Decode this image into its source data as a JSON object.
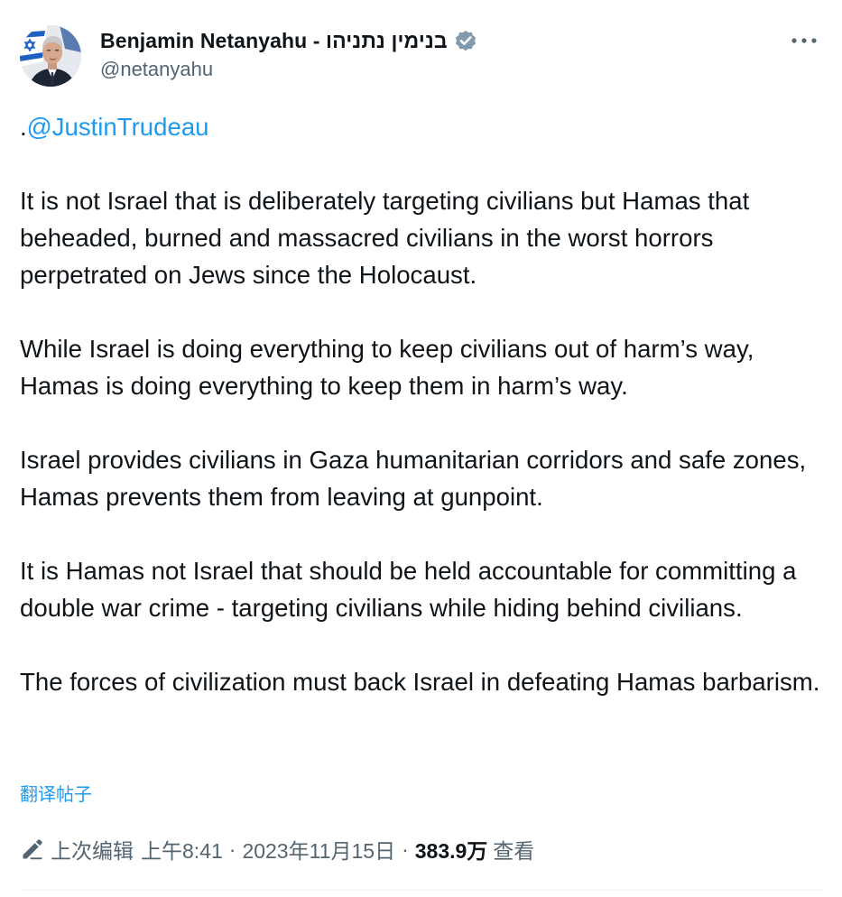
{
  "author": {
    "display_name": "Benjamin Netanyahu - בנימין נתניהו",
    "handle": "@netanyahu",
    "verified_badge_color": "#829aab"
  },
  "tweet": {
    "lead_punct": ".",
    "mention": "@JustinTrudeau",
    "paragraphs": [
      "It is not Israel that is deliberately targeting civilians but Hamas that beheaded, burned and massacred civilians in the worst horrors perpetrated on Jews since the Holocaust.",
      "While Israel is doing everything to keep civilians out of harm’s way, Hamas is doing everything to keep them in harm’s way.",
      "Israel provides civilians in Gaza humanitarian corridors and safe zones, Hamas prevents them from leaving at gunpoint.",
      "It is Hamas not Israel that should be held accountable for committing a double war crime - targeting civilians while hiding behind civilians.",
      "The forces of civilization must back Israel in defeating Hamas barbarism."
    ],
    "translate_label": "翻译帖子"
  },
  "meta": {
    "edited_label": "上次编辑",
    "time": "上午8:41",
    "separator": "·",
    "date": "2023年11月15日",
    "views_count": "383.9万",
    "views_label": "查看"
  },
  "icons": {
    "more": "more-dots-icon",
    "verified": "verified-badge-icon",
    "edited": "pencil-icon"
  },
  "colors": {
    "link": "#1d9bf0",
    "secondary_text": "#536471",
    "primary_text": "#0f1419"
  }
}
